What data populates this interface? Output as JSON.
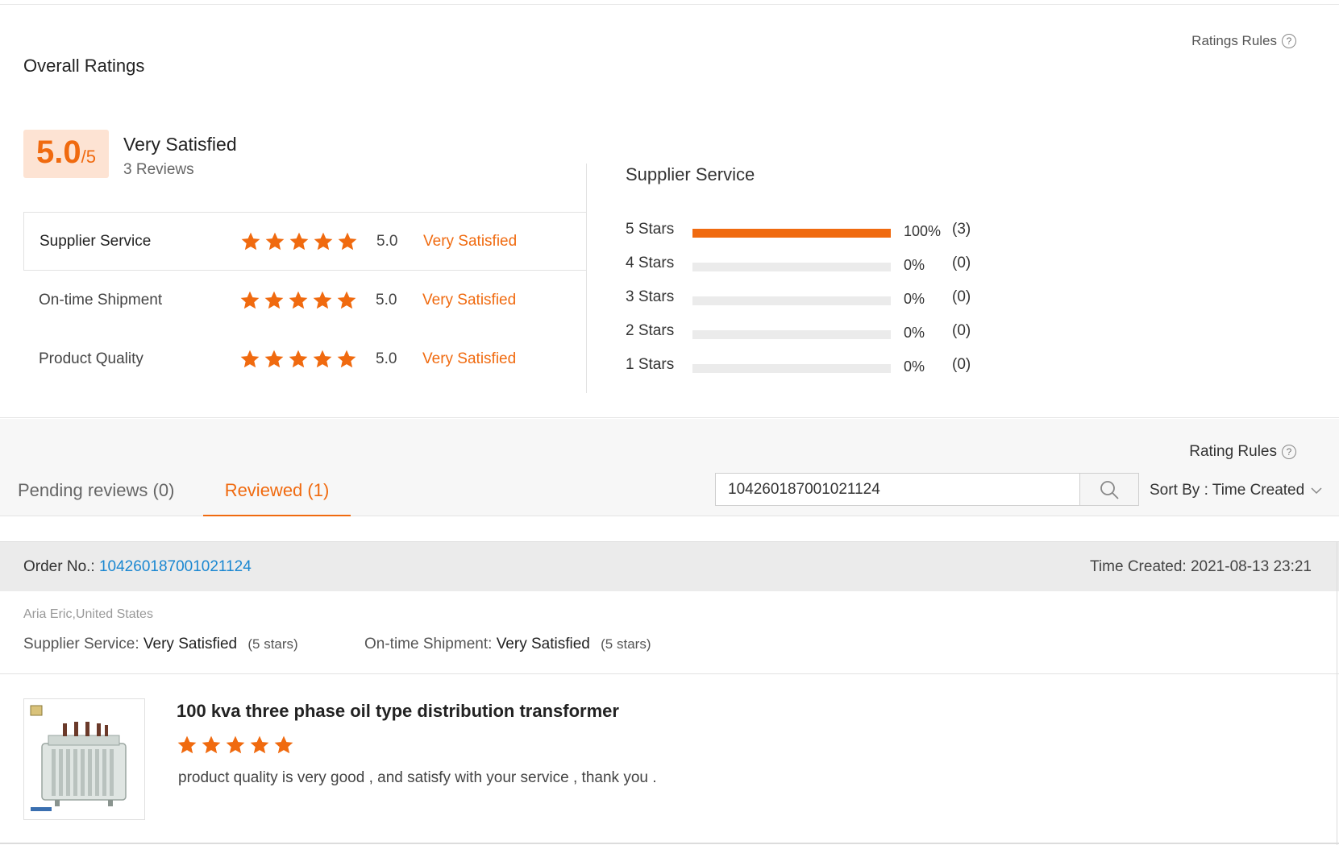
{
  "header": {
    "ratings_rules": "Ratings Rules",
    "title": "Overall Ratings"
  },
  "overall": {
    "score": "5.0",
    "out_of": "/5",
    "label": "Very Satisfied",
    "reviews": "3 Reviews"
  },
  "categories": [
    {
      "name": "Supplier Service",
      "stars": 5,
      "score": "5.0",
      "level": "Very Satisfied"
    },
    {
      "name": "On-time Shipment",
      "stars": 5,
      "score": "5.0",
      "level": "Very Satisfied"
    },
    {
      "name": "Product Quality",
      "stars": 5,
      "score": "5.0",
      "level": "Very Satisfied"
    }
  ],
  "distribution": {
    "title": "Supplier Service",
    "rows": [
      {
        "label": "5  Stars",
        "fraction": 1.0,
        "pct": "100%",
        "count": "(3)"
      },
      {
        "label": "4  Stars",
        "fraction": 0,
        "pct": "0%",
        "count": "(0)"
      },
      {
        "label": "3  Stars",
        "fraction": 0,
        "pct": "0%",
        "count": "(0)"
      },
      {
        "label": "2  Stars",
        "fraction": 0,
        "pct": "0%",
        "count": "(0)"
      },
      {
        "label": "1  Stars",
        "fraction": 0,
        "pct": "0%",
        "count": "(0)"
      }
    ]
  },
  "reviews_section": {
    "rating_rules": "Rating Rules",
    "tabs": {
      "pending": "Pending reviews (0)",
      "reviewed": "Reviewed (1)"
    },
    "search": {
      "value": "104260187001021124"
    },
    "sort": "Sort By : Time Created"
  },
  "order": {
    "no_label": "Order No.:",
    "no_value": "104260187001021124",
    "time_created": "Time Created: 2021-08-13 23:21",
    "reviewer": "Aria Eric,United States",
    "supplier_service_label": "Supplier Service:",
    "supplier_service_value": "Very Satisfied",
    "supplier_service_stars": "(5 stars)",
    "shipment_label": "On-time Shipment:",
    "shipment_value": "Very Satisfied",
    "shipment_stars": "(5 stars)"
  },
  "product": {
    "title": "100 kva three phase oil type distribution transformer",
    "stars": 5,
    "review": "product quality is very good , and satisfy with your service , thank you ."
  },
  "colors": {
    "accent": "#f06a0f",
    "link": "#1a87d1",
    "score_bg": "#fde3d3"
  }
}
